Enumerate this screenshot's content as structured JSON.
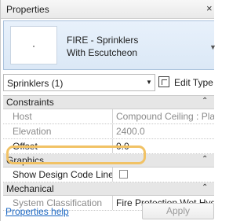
{
  "panel": {
    "title": "Properties",
    "close_glyph": "×"
  },
  "type_selector": {
    "name_line1": "FIRE - Sprinklers",
    "name_line2": "With Escutcheon",
    "chevron_icon": "chevron-down-icon"
  },
  "instance": {
    "selected": "Sprinklers (1)",
    "edit_type_label": "Edit Type",
    "edit_type_icon": "edit-type-icon"
  },
  "sections": {
    "constraints": "Constraints",
    "graphics": "Graphics",
    "mechanical": "Mechanical",
    "toggle_glyph": "⌃"
  },
  "rows": {
    "host": {
      "label": "Host",
      "value": "Compound Ceiling : Plain"
    },
    "elevation": {
      "label": "Elevation",
      "value": "2400.0"
    },
    "offset": {
      "label": "Offset",
      "value": "0.0"
    },
    "show_design_code_lines": {
      "label": "Show Design Code Lines",
      "checked": false
    },
    "system_classification": {
      "label": "System Classification",
      "value": "Fire Protection Wet,Hyd..."
    }
  },
  "footer": {
    "help_link": "Properties help",
    "apply_label": "Apply"
  },
  "colors": {
    "highlight": "#f1c265",
    "link": "#1a66c2",
    "selector_bg": "#dbe8f6"
  }
}
